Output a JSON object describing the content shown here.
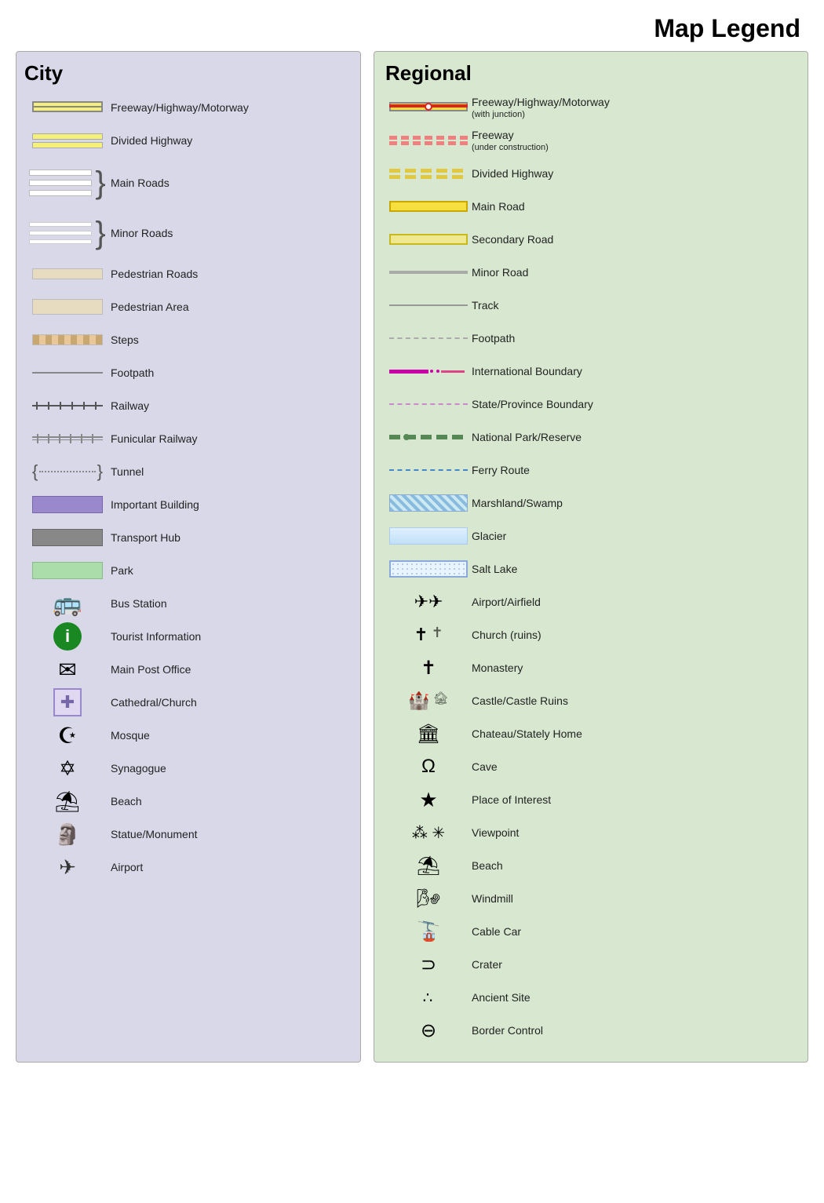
{
  "title": "Map Legend",
  "city": {
    "title": "City",
    "items": [
      {
        "id": "freeway",
        "label": "Freeway/Highway/Motorway"
      },
      {
        "id": "divided-highway",
        "label": "Divided Highway"
      },
      {
        "id": "main-roads",
        "label": "Main Roads"
      },
      {
        "id": "minor-roads",
        "label": "Minor Roads"
      },
      {
        "id": "pedestrian-roads",
        "label": "Pedestrian Roads"
      },
      {
        "id": "pedestrian-area",
        "label": "Pedestrian Area"
      },
      {
        "id": "steps",
        "label": "Steps"
      },
      {
        "id": "footpath",
        "label": "Footpath"
      },
      {
        "id": "railway",
        "label": "Railway"
      },
      {
        "id": "funicular",
        "label": "Funicular Railway"
      },
      {
        "id": "tunnel",
        "label": "Tunnel"
      },
      {
        "id": "important-building",
        "label": "Important Building"
      },
      {
        "id": "transport-hub",
        "label": "Transport Hub"
      },
      {
        "id": "park",
        "label": "Park"
      },
      {
        "id": "bus-station",
        "label": "Bus Station"
      },
      {
        "id": "tourist-info",
        "label": "Tourist Information"
      },
      {
        "id": "post-office",
        "label": "Main Post Office"
      },
      {
        "id": "cathedral",
        "label": "Cathedral/Church"
      },
      {
        "id": "mosque",
        "label": "Mosque"
      },
      {
        "id": "synagogue",
        "label": "Synagogue"
      },
      {
        "id": "beach-city",
        "label": "Beach"
      },
      {
        "id": "statue",
        "label": "Statue/Monument"
      },
      {
        "id": "airport-city",
        "label": "Airport"
      }
    ]
  },
  "regional": {
    "title": "Regional",
    "items": [
      {
        "id": "reg-freeway",
        "label": "Freeway/Highway/Motorway",
        "sublabel": "(with junction)"
      },
      {
        "id": "reg-freeway-construction",
        "label": "Freeway",
        "sublabel": "(under construction)"
      },
      {
        "id": "reg-divided",
        "label": "Divided Highway"
      },
      {
        "id": "reg-main-road",
        "label": "Main Road"
      },
      {
        "id": "reg-secondary",
        "label": "Secondary Road"
      },
      {
        "id": "reg-minor",
        "label": "Minor Road"
      },
      {
        "id": "reg-track",
        "label": "Track"
      },
      {
        "id": "reg-footpath",
        "label": "Footpath"
      },
      {
        "id": "intl-boundary",
        "label": "International Boundary"
      },
      {
        "id": "state-boundary",
        "label": "State/Province Boundary"
      },
      {
        "id": "national-park",
        "label": "National Park/Reserve"
      },
      {
        "id": "ferry",
        "label": "Ferry Route"
      },
      {
        "id": "marshland",
        "label": "Marshland/Swamp"
      },
      {
        "id": "glacier",
        "label": "Glacier"
      },
      {
        "id": "salt-lake",
        "label": "Salt Lake"
      },
      {
        "id": "airport",
        "label": "Airport/Airfield"
      },
      {
        "id": "church",
        "label": "Church (ruins)"
      },
      {
        "id": "monastery",
        "label": "Monastery"
      },
      {
        "id": "castle",
        "label": "Castle/Castle Ruins"
      },
      {
        "id": "chateau",
        "label": "Chateau/Stately Home"
      },
      {
        "id": "cave",
        "label": "Cave"
      },
      {
        "id": "place-interest",
        "label": "Place of Interest"
      },
      {
        "id": "viewpoint",
        "label": "Viewpoint"
      },
      {
        "id": "beach",
        "label": "Beach"
      },
      {
        "id": "windmill",
        "label": "Windmill"
      },
      {
        "id": "cable-car",
        "label": "Cable Car"
      },
      {
        "id": "crater",
        "label": "Crater"
      },
      {
        "id": "ancient-site",
        "label": "Ancient Site"
      },
      {
        "id": "border-control",
        "label": "Border Control"
      }
    ]
  }
}
